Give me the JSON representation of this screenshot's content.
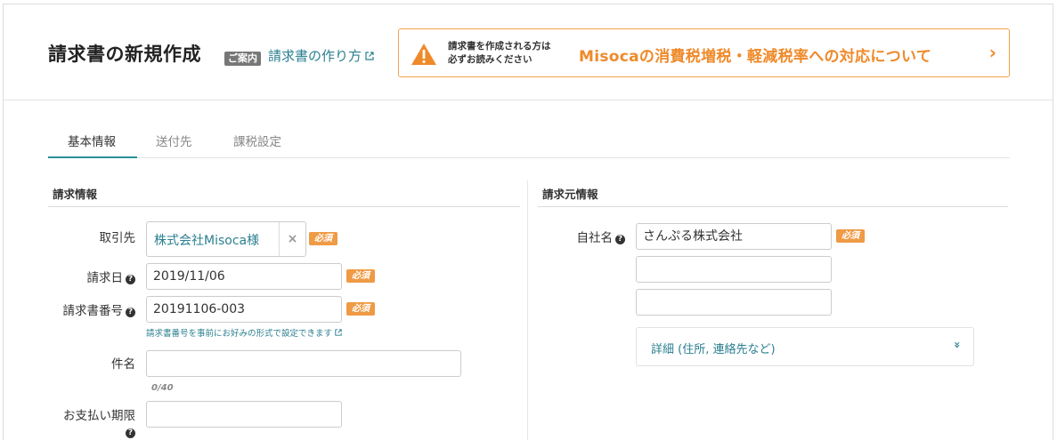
{
  "header": {
    "title": "請求書の新規作成",
    "guide_badge": "ご案内",
    "howto_link": "請求書の作り方",
    "notice": {
      "small_line1": "請求書を作成される方は",
      "small_line2": "必ずお読みください",
      "main": "Misocaの消費税増税・軽減税率への対応について",
      "chevron": "›"
    }
  },
  "tabs": [
    {
      "label": "基本情報",
      "active": true
    },
    {
      "label": "送付先",
      "active": false
    },
    {
      "label": "課税設定",
      "active": false
    }
  ],
  "billing": {
    "section_title": "請求情報",
    "client_label": "取引先",
    "client_value": "株式会社Misoca様",
    "clear_icon": "×",
    "date_label": "請求日",
    "date_value": "2019/11/06",
    "number_label": "請求書番号",
    "number_value": "20191106-003",
    "number_hint": "請求書番号を事前にお好みの形式で設定できます",
    "subject_label": "件名",
    "subject_value": "",
    "subject_counter": "0/40",
    "due_label": "お支払い期限",
    "due_value": ""
  },
  "issuer": {
    "section_title": "請求元情報",
    "company_label": "自社名",
    "company_value": "さんぷる株式会社",
    "extra1_value": "",
    "extra2_value": "",
    "details_label": "詳細 (住所, 連絡先など)",
    "details_chevron": "»"
  },
  "required_label": "必須",
  "help_glyph": "?",
  "colors": {
    "accent": "#2a8f9a",
    "link": "#2a7f8f",
    "notice_orange": "#ef8a2a",
    "required_orange": "#ef9a45"
  },
  "icons": {
    "external_link": "external-link-icon",
    "warning": "warning-icon",
    "help": "help-icon",
    "clear": "close-icon",
    "expand": "chevron-double-down-icon"
  }
}
